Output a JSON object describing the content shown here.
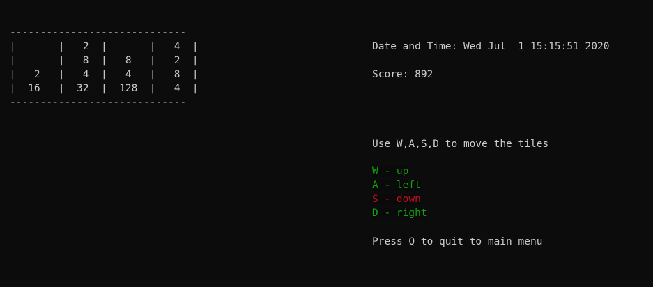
{
  "board": {
    "border": "-----------------------------",
    "rows": [
      "|       |   2  |       |   4  |",
      "|       |   8  |   8   |   2  |",
      "|   2   |   4  |   4   |   8  |",
      "|  16   |  32  |  128  |   4  |"
    ],
    "cells": [
      [
        null,
        2,
        null,
        4
      ],
      [
        null,
        8,
        8,
        2
      ],
      [
        2,
        4,
        4,
        8
      ],
      [
        16,
        32,
        128,
        4
      ]
    ]
  },
  "info": {
    "datetime": "Date and Time: Wed Jul  1 15:15:51 2020",
    "score": "Score: 892",
    "instructions": "Use W,A,S,D to move the tiles",
    "quit": "Press Q to quit to main menu"
  },
  "controls": [
    {
      "label": "W - up",
      "color": "#13a10e"
    },
    {
      "label": "A - left",
      "color": "#13a10e"
    },
    {
      "label": "S - down",
      "color": "#c50f1f"
    },
    {
      "label": "D - right",
      "color": "#13a10e"
    }
  ]
}
